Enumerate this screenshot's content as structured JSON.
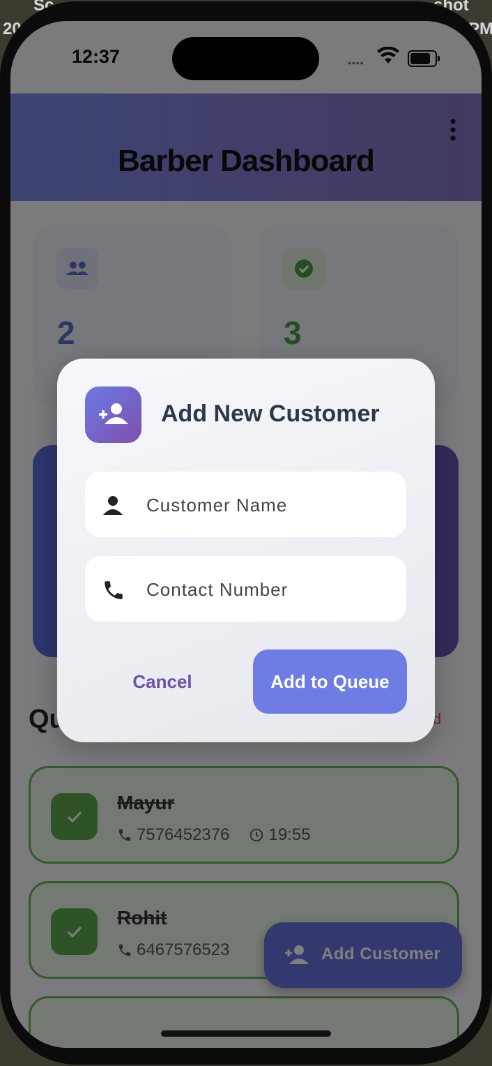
{
  "desktop": {
    "left_text": "Sc",
    "left_text_2": "20",
    "right_text": "shot",
    "right_text_2": "PM"
  },
  "status_bar": {
    "time": "12:37"
  },
  "header": {
    "title": "Barber Dashboard"
  },
  "stats": [
    {
      "value": "2",
      "icon": "people-icon",
      "color": "#5a6ec8"
    },
    {
      "value": "3",
      "icon": "check-circle-icon",
      "color": "#4a9a46"
    }
  ],
  "queue": {
    "title_visible": "Qu",
    "clear_visible": "d",
    "items": [
      {
        "name": "Mayur",
        "phone": "7576452376",
        "time": "19:55"
      },
      {
        "name": "Rohit",
        "phone": "6467576523",
        "time": ""
      }
    ]
  },
  "fab": {
    "label": "Add Customer",
    "icon": "person-add-icon"
  },
  "dialog": {
    "title": "Add New Customer",
    "icon": "person-add-icon",
    "name_field": {
      "placeholder": "Customer Name",
      "icon": "person-icon"
    },
    "contact_field": {
      "placeholder": "Contact Number",
      "icon": "phone-icon"
    },
    "cancel_label": "Cancel",
    "submit_label": "Add to Queue",
    "accent": "#6d7de4"
  }
}
